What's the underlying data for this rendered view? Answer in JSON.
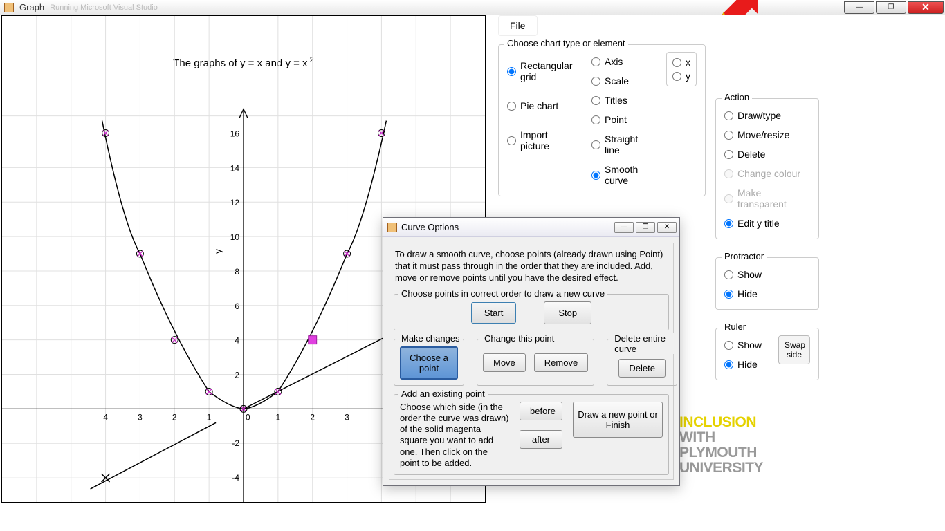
{
  "outer_window": {
    "title": "Graph",
    "faded": "Running   Microsoft Visual Studio"
  },
  "chart_data": {
    "type": "line",
    "title": "The graphs of y = x and y = x²",
    "xlabel": "",
    "ylabel": "y",
    "xlim": [
      -5,
      5
    ],
    "ylim": [
      -5,
      17
    ],
    "x_ticks": [
      -4,
      -3,
      -2,
      -1,
      0,
      1,
      2,
      3
    ],
    "y_ticks": [
      -4,
      -2,
      0,
      2,
      4,
      6,
      8,
      10,
      12,
      14,
      16
    ],
    "series": [
      {
        "name": "y = x",
        "x": [
          -4,
          4
        ],
        "values": [
          -4,
          4
        ]
      },
      {
        "name": "y = x²",
        "x": [
          -4,
          -3,
          -2,
          -1,
          0,
          1,
          2,
          3,
          4
        ],
        "values": [
          16,
          9,
          4,
          1,
          0,
          1,
          4,
          9,
          16
        ]
      }
    ],
    "marked_points_parabola": [
      [
        -4,
        16
      ],
      [
        -3,
        9
      ],
      [
        -2,
        4
      ],
      [
        -1,
        1
      ],
      [
        0,
        0
      ],
      [
        1,
        1
      ],
      [
        2,
        4
      ],
      [
        3,
        9
      ]
    ],
    "marked_points_line": [
      [
        -4,
        -4
      ],
      [
        2,
        2
      ]
    ],
    "selected_point": [
      2,
      4
    ]
  },
  "menu": {
    "file": "File"
  },
  "chart_type_group": {
    "title": "Choose chart type or element",
    "rect": "Rectangular grid",
    "pie": "Pie chart",
    "import": "Import picture",
    "axis": "Axis",
    "scale": "Scale",
    "titles": "Titles",
    "point": "Point",
    "straight": "Straight line",
    "smooth": "Smooth curve",
    "x": "x",
    "y": "y"
  },
  "action_group": {
    "title": "Action",
    "draw": "Draw/type",
    "move": "Move/resize",
    "delete": "Delete",
    "colour": "Change colour",
    "transparent": "Make transparent",
    "edity": "Edit y title"
  },
  "protractor": {
    "title": "Protractor",
    "show": "Show",
    "hide": "Hide"
  },
  "ruler": {
    "title": "Ruler",
    "show": "Show",
    "hide": "Hide",
    "swap": "Swap side"
  },
  "curve_dialog": {
    "title": "Curve Options",
    "desc": "To draw a smooth curve, choose points (already drawn using Point) that it must pass through in the order that they are included. Add, move or remove points until you have the desired effect.",
    "choose_title": "Choose points in correct order to draw a new curve",
    "start": "Start",
    "stop": "Stop",
    "make_changes": "Make changes",
    "choose_point": "Choose a point",
    "change_this": "Change this point",
    "move": "Move",
    "remove": "Remove",
    "delete_curve": "Delete entire curve",
    "delete": "Delete",
    "add_existing": "Add an existing point",
    "add_desc": "Choose which side (in the order the curve was drawn) of the solid magenta square you want to add one.  Then click on the point to be added.",
    "before": "before",
    "after": "after",
    "draw_new": "Draw a new point or Finish"
  },
  "plymouth": {
    "l1": "INCLUSION",
    "l2": "WITH",
    "l3": "PLYMOUTH",
    "l4": "UNIVERSITY"
  }
}
